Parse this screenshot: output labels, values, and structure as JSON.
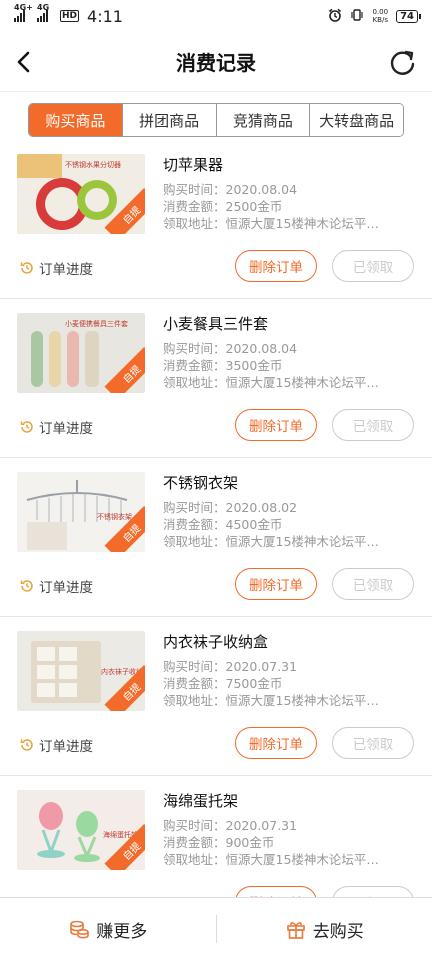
{
  "statusbar": {
    "net1": "4G+",
    "net2": "4G",
    "hd": "HD",
    "time": "4:11",
    "speed_value": "0.00",
    "speed_unit": "KB/s",
    "battery": "74"
  },
  "header": {
    "title": "消费记录",
    "back_icon": "chevron-left-icon",
    "refresh_icon": "refresh-icon"
  },
  "tabs": [
    {
      "label": "购买商品",
      "active": true
    },
    {
      "label": "拼团商品",
      "active": false
    },
    {
      "label": "竞猜商品",
      "active": false
    },
    {
      "label": "大转盘商品",
      "active": false
    }
  ],
  "labels": {
    "purchase_time": "购买时间：",
    "amount": "消费金额：",
    "address": "领取地址：",
    "progress": "订单进度",
    "delete": "删除订单",
    "received": "已领取",
    "self_pickup": "自提"
  },
  "orders": [
    {
      "name": "切苹果器",
      "time": "2020.08.04",
      "amount": "2500金币",
      "address": "恒源大厦15楼神木论坛平…",
      "thumb_text": "不锈钢水果分切器"
    },
    {
      "name": "小麦餐具三件套",
      "time": "2020.08.04",
      "amount": "3500金币",
      "address": "恒源大厦15楼神木论坛平…",
      "thumb_text": "小麦便携餐具三件套"
    },
    {
      "name": "不锈钢衣架",
      "time": "2020.08.02",
      "amount": "4500金币",
      "address": "恒源大厦15楼神木论坛平…",
      "thumb_text": "不锈钢衣架"
    },
    {
      "name": "内衣袜子收纳盒",
      "time": "2020.07.31",
      "amount": "7500金币",
      "address": "恒源大厦15楼神木论坛平…",
      "thumb_text": "内衣袜子收纳"
    },
    {
      "name": "海绵蛋托架",
      "time": "2020.07.31",
      "amount": "900金币",
      "address": "恒源大厦15楼神木论坛平…",
      "thumb_text": "海绵蛋托架"
    }
  ],
  "bottom": {
    "earn_more": "赚更多",
    "go_buy": "去购买"
  },
  "colors": {
    "accent": "#f26b2a",
    "thumb_bgs": [
      "#f1ece4",
      "#e8e6e0",
      "#f4f2ef",
      "#eceae5",
      "#f3ece8"
    ]
  }
}
